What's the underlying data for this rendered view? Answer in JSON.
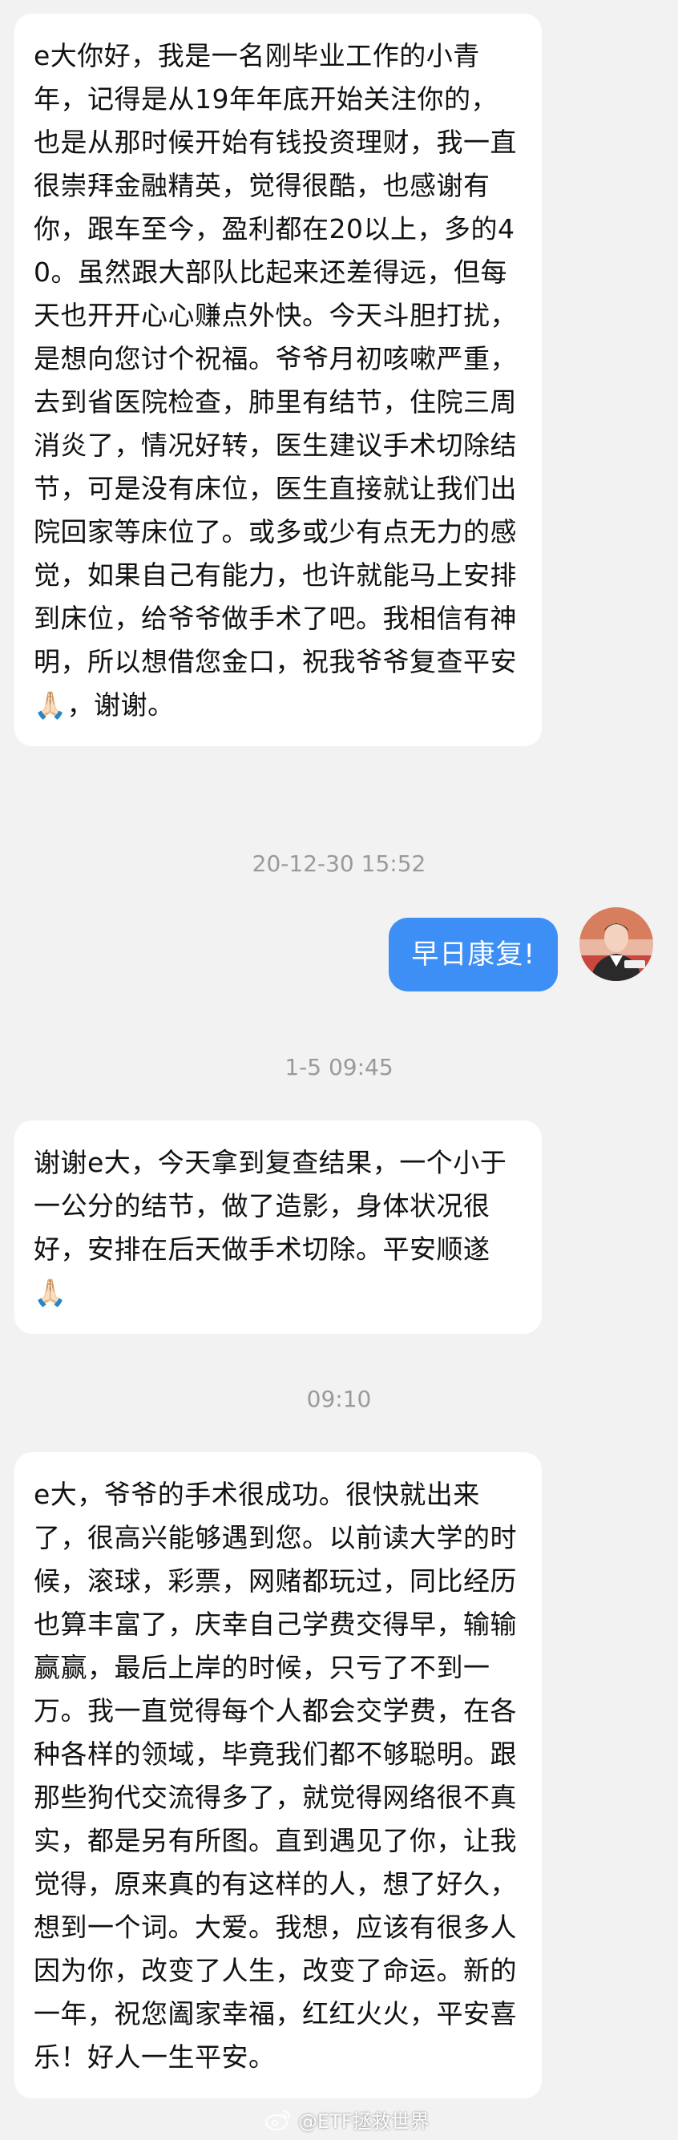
{
  "messages": [
    {
      "text": "e大你好，我是一名刚毕业工作的小青年，记得是从19年年底开始关注你的，也是从那时候开始有钱投资理财，我一直很崇拜金融精英，觉得很酷，也感谢有你，跟车至今，盈利都在20以上，多的40。虽然跟大部队比起来还差得远，但每天也开开心心赚点外快。今天斗胆打扰，是想向您讨个祝福。爷爷月初咳嗽严重，去到省医院检查，肺里有结节，住院三周消炎了，情况好转，医生建议手术切除结节，可是没有床位，医生直接就让我们出院回家等床位了。或多或少有点无力的感觉，如果自己有能力，也许就能马上安排到床位，给爷爷做手术了吧。我相信有神明，所以想借您金口，祝我爷爷复查平安🙏🏻，谢谢。"
    },
    {
      "timestamp": "20-12-30 15:52"
    },
    {
      "reply": "早日康复!"
    },
    {
      "timestamp": "1-5 09:45"
    },
    {
      "text": "谢谢e大，今天拿到复查结果，一个小于一公分的结节，做了造影，身体状况很好，安排在后天做手术切除。平安顺遂🙏🏻"
    },
    {
      "timestamp": "09:10"
    },
    {
      "text": "e大，爷爷的手术很成功。很快就出来了，很高兴能够遇到您。以前读大学的时候，滚球，彩票，网赌都玩过，同比经历也算丰富了，庆幸自己学费交得早，输输赢赢，最后上岸的时候，只亏了不到一万。我一直觉得每个人都会交学费，在各种各样的领域，毕竟我们都不够聪明。跟那些狗代交流得多了，就觉得网络很不真实，都是另有所图。直到遇见了你，让我觉得，原来真的有这样的人，想了好久，想到一个词。大爱。我想，应该有很多人因为你，改变了人生，改变了命运。新的一年，祝您阖家幸福，红红火火，平安喜乐！好人一生平安。"
    }
  ],
  "watermark": "@ETF拯救世界",
  "colors": {
    "background": "#f2f2f2",
    "incoming_bubble": "#ffffff",
    "outgoing_bubble": "#3d8ff5",
    "timestamp": "#9a9a9a"
  },
  "icons": {
    "avatar": "avatar-photo",
    "watermark": "weibo-icon"
  }
}
